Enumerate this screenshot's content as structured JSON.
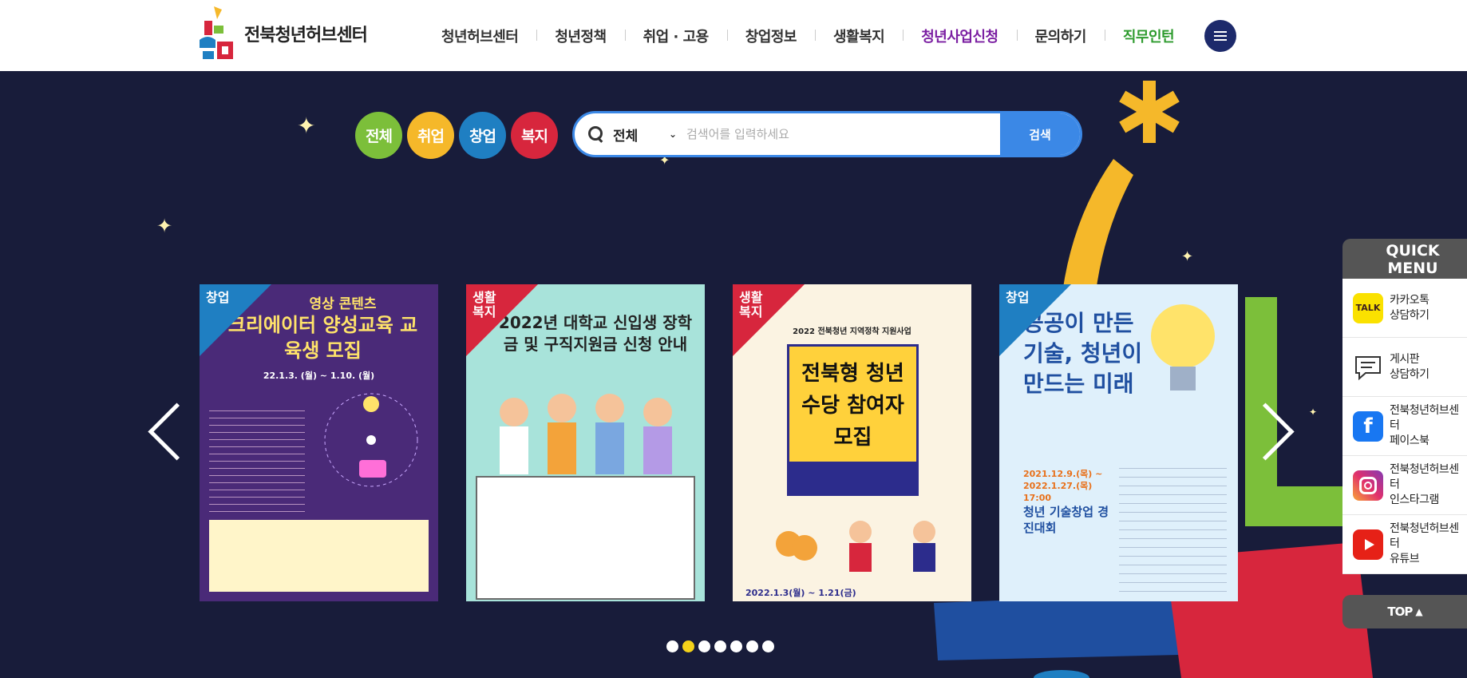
{
  "header": {
    "logo_text": "전북청년허브센터",
    "nav": [
      {
        "label": "청년허브센터"
      },
      {
        "label": "청년정책"
      },
      {
        "label": "취업 · 고용"
      },
      {
        "label": "창업정보"
      },
      {
        "label": "생활복지"
      },
      {
        "label": "청년사업신청"
      },
      {
        "label": "문의하기"
      },
      {
        "label": "직무인턴"
      }
    ]
  },
  "categories": [
    {
      "label": "전체",
      "color": "#7cbf3a"
    },
    {
      "label": "취업",
      "color": "#f5b82a"
    },
    {
      "label": "창업",
      "color": "#1f7fc2"
    },
    {
      "label": "복지",
      "color": "#d7263d"
    }
  ],
  "search": {
    "select_value": "전체",
    "placeholder": "검색어를 입력하세요",
    "button_label": "검색"
  },
  "cards": [
    {
      "tag": "창업",
      "tag_color": "#1f7fc2",
      "heading": "크리에이터 양성교육 교육생 모집",
      "sub": "영상 콘텐츠",
      "date": "22.1.3. (월) ~ 1.10. (월)"
    },
    {
      "tag": "생활 복지",
      "tag_color": "#d7263d",
      "heading": "2022년 대학교 신입생 장학금 및 구직지원금 신청 안내",
      "sub": "",
      "date": ""
    },
    {
      "tag": "생활 복지",
      "tag_color": "#d7263d",
      "heading": "전북형 청년수당 참여자 모집",
      "sub": "2022 전북청년 지역정착 지원사업",
      "date": "2022.1.3(월) ~ 1.21(금)"
    },
    {
      "tag": "창업",
      "tag_color": "#1f7fc2",
      "heading": "공공이 만든 기술, 청년이 만드는 미래",
      "sub": "청년 기술창업 경진대회",
      "date": "2021.12.9.(목) ~ 2022.1.27.(목) 17:00"
    }
  ],
  "pagination": {
    "total": 7,
    "active": 1
  },
  "quick_menu": {
    "title": "QUICK MENU",
    "items": [
      {
        "label": "카카오톡\n상담하기",
        "icon": "kakaotalk-icon"
      },
      {
        "label": "게시판\n상담하기",
        "icon": "board-chat-icon"
      },
      {
        "label": "전북청년허브센터\n페이스북",
        "icon": "facebook-icon"
      },
      {
        "label": "전북청년허브센터\n인스타그램",
        "icon": "instagram-icon"
      },
      {
        "label": "전북청년허브센터\n유튜브",
        "icon": "youtube-icon"
      }
    ],
    "top_label": "TOP"
  }
}
